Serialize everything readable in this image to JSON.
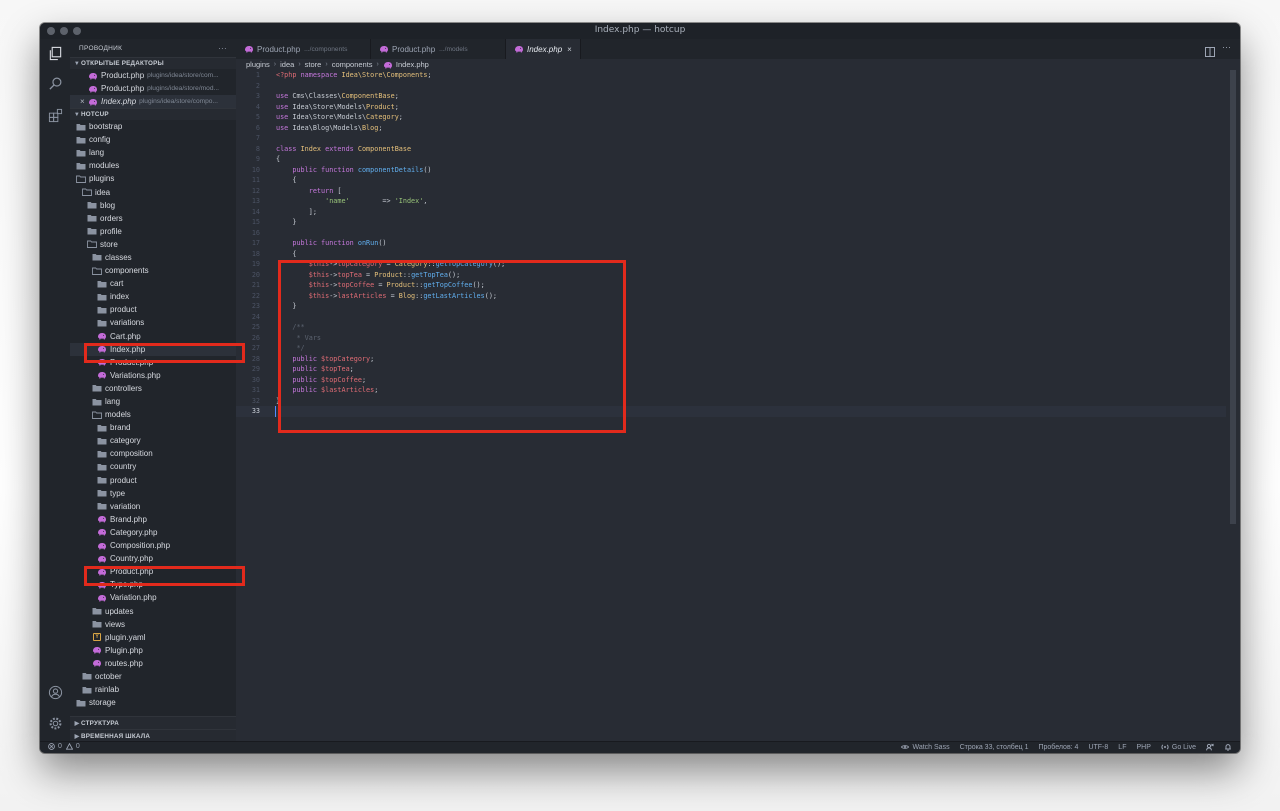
{
  "window": {
    "title": "Index.php — hotcup"
  },
  "sidebar": {
    "header": "ПРОВОДНИК",
    "more_glyph": "···",
    "open_editors_title": "ОТКРЫТЫЕ РЕДАКТОРЫ",
    "open_editors": [
      {
        "name": "Product.php",
        "path": "plugins/idea/store/com..."
      },
      {
        "name": "Product.php",
        "path": "plugins/idea/store/mod..."
      },
      {
        "name": "Index.php",
        "path": "plugins/idea/store/compo..."
      }
    ],
    "project_title": "HOTCUP",
    "tree": [
      {
        "label": "bootstrap",
        "depth": 0,
        "kind": "folder"
      },
      {
        "label": "config",
        "depth": 0,
        "kind": "folder"
      },
      {
        "label": "lang",
        "depth": 0,
        "kind": "folder"
      },
      {
        "label": "modules",
        "depth": 0,
        "kind": "folder"
      },
      {
        "label": "plugins",
        "depth": 0,
        "kind": "folder-open"
      },
      {
        "label": "idea",
        "depth": 1,
        "kind": "folder-open"
      },
      {
        "label": "blog",
        "depth": 2,
        "kind": "folder"
      },
      {
        "label": "orders",
        "depth": 2,
        "kind": "folder"
      },
      {
        "label": "profile",
        "depth": 2,
        "kind": "folder"
      },
      {
        "label": "store",
        "depth": 2,
        "kind": "folder-open"
      },
      {
        "label": "classes",
        "depth": 3,
        "kind": "folder"
      },
      {
        "label": "components",
        "depth": 3,
        "kind": "folder-open"
      },
      {
        "label": "cart",
        "depth": 4,
        "kind": "folder"
      },
      {
        "label": "index",
        "depth": 4,
        "kind": "folder"
      },
      {
        "label": "product",
        "depth": 4,
        "kind": "folder"
      },
      {
        "label": "variations",
        "depth": 4,
        "kind": "folder"
      },
      {
        "label": "Cart.php",
        "depth": 4,
        "kind": "php"
      },
      {
        "label": "Index.php",
        "depth": 4,
        "kind": "php"
      },
      {
        "label": "Product.php",
        "depth": 4,
        "kind": "php"
      },
      {
        "label": "Variations.php",
        "depth": 4,
        "kind": "php"
      },
      {
        "label": "controllers",
        "depth": 3,
        "kind": "folder"
      },
      {
        "label": "lang",
        "depth": 3,
        "kind": "folder"
      },
      {
        "label": "models",
        "depth": 3,
        "kind": "folder-open"
      },
      {
        "label": "brand",
        "depth": 4,
        "kind": "folder"
      },
      {
        "label": "category",
        "depth": 4,
        "kind": "folder"
      },
      {
        "label": "composition",
        "depth": 4,
        "kind": "folder"
      },
      {
        "label": "country",
        "depth": 4,
        "kind": "folder"
      },
      {
        "label": "product",
        "depth": 4,
        "kind": "folder"
      },
      {
        "label": "type",
        "depth": 4,
        "kind": "folder"
      },
      {
        "label": "variation",
        "depth": 4,
        "kind": "folder"
      },
      {
        "label": "Brand.php",
        "depth": 4,
        "kind": "php"
      },
      {
        "label": "Category.php",
        "depth": 4,
        "kind": "php"
      },
      {
        "label": "Composition.php",
        "depth": 4,
        "kind": "php"
      },
      {
        "label": "Country.php",
        "depth": 4,
        "kind": "php"
      },
      {
        "label": "Product.php",
        "depth": 4,
        "kind": "php"
      },
      {
        "label": "Type.php",
        "depth": 4,
        "kind": "php"
      },
      {
        "label": "Variation.php",
        "depth": 4,
        "kind": "php"
      },
      {
        "label": "updates",
        "depth": 3,
        "kind": "folder"
      },
      {
        "label": "views",
        "depth": 3,
        "kind": "folder"
      },
      {
        "label": "plugin.yaml",
        "depth": 3,
        "kind": "yaml"
      },
      {
        "label": "Plugin.php",
        "depth": 3,
        "kind": "php"
      },
      {
        "label": "routes.php",
        "depth": 3,
        "kind": "php"
      },
      {
        "label": "october",
        "depth": 1,
        "kind": "folder"
      },
      {
        "label": "rainlab",
        "depth": 1,
        "kind": "folder"
      },
      {
        "label": "storage",
        "depth": 0,
        "kind": "folder"
      }
    ],
    "outline_title": "СТРУКТУРА",
    "timeline_title": "ВРЕМЕННАЯ ШКАЛА"
  },
  "tabs": [
    {
      "name": "Product.php",
      "path": ".../components",
      "active": false
    },
    {
      "name": "Product.php",
      "path": ".../models",
      "active": false
    },
    {
      "name": "Index.php",
      "path": "",
      "active": true,
      "close": "×"
    }
  ],
  "breadcrumbs": [
    "plugins",
    "idea",
    "store",
    "components",
    "Index.php"
  ],
  "code": {
    "current_line": 33,
    "lines": [
      [
        [
          "<?php ",
          "#e06c75"
        ],
        [
          "namespace ",
          "#c678dd"
        ],
        [
          "Idea\\Store\\Components",
          "#e5c07b"
        ],
        [
          ";",
          "#c7ccd4"
        ]
      ],
      [],
      [
        [
          "use ",
          "#c678dd"
        ],
        [
          "Cms\\Classes\\",
          "#c7ccd4"
        ],
        [
          "ComponentBase",
          "#e5c07b"
        ],
        [
          ";",
          "#c7ccd4"
        ]
      ],
      [
        [
          "use ",
          "#c678dd"
        ],
        [
          "Idea\\Store\\Models\\",
          "#c7ccd4"
        ],
        [
          "Product",
          "#e5c07b"
        ],
        [
          ";",
          "#c7ccd4"
        ]
      ],
      [
        [
          "use ",
          "#c678dd"
        ],
        [
          "Idea\\Store\\Models\\",
          "#c7ccd4"
        ],
        [
          "Category",
          "#e5c07b"
        ],
        [
          ";",
          "#c7ccd4"
        ]
      ],
      [
        [
          "use ",
          "#c678dd"
        ],
        [
          "Idea\\Blog\\Models\\",
          "#c7ccd4"
        ],
        [
          "Blog",
          "#e5c07b"
        ],
        [
          ";",
          "#c7ccd4"
        ]
      ],
      [],
      [
        [
          "class ",
          "#c678dd"
        ],
        [
          "Index ",
          "#e5c07b"
        ],
        [
          "extends ",
          "#c678dd"
        ],
        [
          "ComponentBase",
          "#e5c07b"
        ]
      ],
      [
        [
          "{",
          "#c7ccd4"
        ]
      ],
      [
        [
          "    public ",
          "#c678dd"
        ],
        [
          "function ",
          "#c678dd"
        ],
        [
          "componentDetails",
          "#61afef"
        ],
        [
          "()",
          "#c7ccd4"
        ]
      ],
      [
        [
          "    {",
          "#c7ccd4"
        ]
      ],
      [
        [
          "        return ",
          "#c678dd"
        ],
        [
          "[",
          "#c7ccd4"
        ]
      ],
      [
        [
          "            ",
          "#c7ccd4"
        ],
        [
          "'name'",
          "#98c379"
        ],
        [
          "        => ",
          "#c7ccd4"
        ],
        [
          "'Index'",
          "#98c379"
        ],
        [
          ",",
          "#c7ccd4"
        ]
      ],
      [
        [
          "        ];",
          "#c7ccd4"
        ]
      ],
      [
        [
          "    }",
          "#c7ccd4"
        ]
      ],
      [],
      [
        [
          "    public ",
          "#c678dd"
        ],
        [
          "function ",
          "#c678dd"
        ],
        [
          "onRun",
          "#61afef"
        ],
        [
          "()",
          "#c7ccd4"
        ]
      ],
      [
        [
          "    {",
          "#c7ccd4"
        ]
      ],
      [
        [
          "        $this",
          "#e06c75"
        ],
        [
          "->",
          "#c7ccd4"
        ],
        [
          "topCategory",
          "#e06c75"
        ],
        [
          " = ",
          "#c7ccd4"
        ],
        [
          "Category",
          "#e5c07b"
        ],
        [
          "::",
          "#c7ccd4"
        ],
        [
          "getTopCategory",
          "#61afef"
        ],
        [
          "();",
          "#c7ccd4"
        ]
      ],
      [
        [
          "        $this",
          "#e06c75"
        ],
        [
          "->",
          "#c7ccd4"
        ],
        [
          "topTea",
          "#e06c75"
        ],
        [
          " = ",
          "#c7ccd4"
        ],
        [
          "Product",
          "#e5c07b"
        ],
        [
          "::",
          "#c7ccd4"
        ],
        [
          "getTopTea",
          "#61afef"
        ],
        [
          "();",
          "#c7ccd4"
        ]
      ],
      [
        [
          "        $this",
          "#e06c75"
        ],
        [
          "->",
          "#c7ccd4"
        ],
        [
          "topCoffee",
          "#e06c75"
        ],
        [
          " = ",
          "#c7ccd4"
        ],
        [
          "Product",
          "#e5c07b"
        ],
        [
          "::",
          "#c7ccd4"
        ],
        [
          "getTopCoffee",
          "#61afef"
        ],
        [
          "();",
          "#c7ccd4"
        ]
      ],
      [
        [
          "        $this",
          "#e06c75"
        ],
        [
          "->",
          "#c7ccd4"
        ],
        [
          "lastArticles",
          "#e06c75"
        ],
        [
          " = ",
          "#c7ccd4"
        ],
        [
          "Blog",
          "#e5c07b"
        ],
        [
          "::",
          "#c7ccd4"
        ],
        [
          "getLastArticles",
          "#61afef"
        ],
        [
          "();",
          "#c7ccd4"
        ]
      ],
      [
        [
          "    }",
          "#c7ccd4"
        ]
      ],
      [],
      [
        [
          "    /**",
          "#5c6370"
        ]
      ],
      [
        [
          "     * Vars",
          "#5c6370"
        ]
      ],
      [
        [
          "     */",
          "#5c6370"
        ]
      ],
      [
        [
          "    public ",
          "#c678dd"
        ],
        [
          "$topCategory",
          "#e06c75"
        ],
        [
          ";",
          "#c7ccd4"
        ]
      ],
      [
        [
          "    public ",
          "#c678dd"
        ],
        [
          "$topTea",
          "#e06c75"
        ],
        [
          ";",
          "#c7ccd4"
        ]
      ],
      [
        [
          "    public ",
          "#c678dd"
        ],
        [
          "$topCoffee",
          "#e06c75"
        ],
        [
          ";",
          "#c7ccd4"
        ]
      ],
      [
        [
          "    public ",
          "#c678dd"
        ],
        [
          "$lastArticles",
          "#e06c75"
        ],
        [
          ";",
          "#c7ccd4"
        ]
      ],
      [
        [
          "}",
          "#c7ccd4"
        ]
      ],
      []
    ]
  },
  "statusbar": {
    "errors": "0",
    "warnings": "0",
    "watch_sass": "Watch Sass",
    "cursor": "Строка 33, столбец 1",
    "spaces": "Пробелов: 4",
    "encoding": "UTF-8",
    "eol": "LF",
    "language": "PHP",
    "go_live": "Go Live"
  },
  "colors": {
    "highlight_box": "#e22a1c",
    "php_icon": "#c36bd8",
    "folder_icon": "#8b93a1"
  }
}
